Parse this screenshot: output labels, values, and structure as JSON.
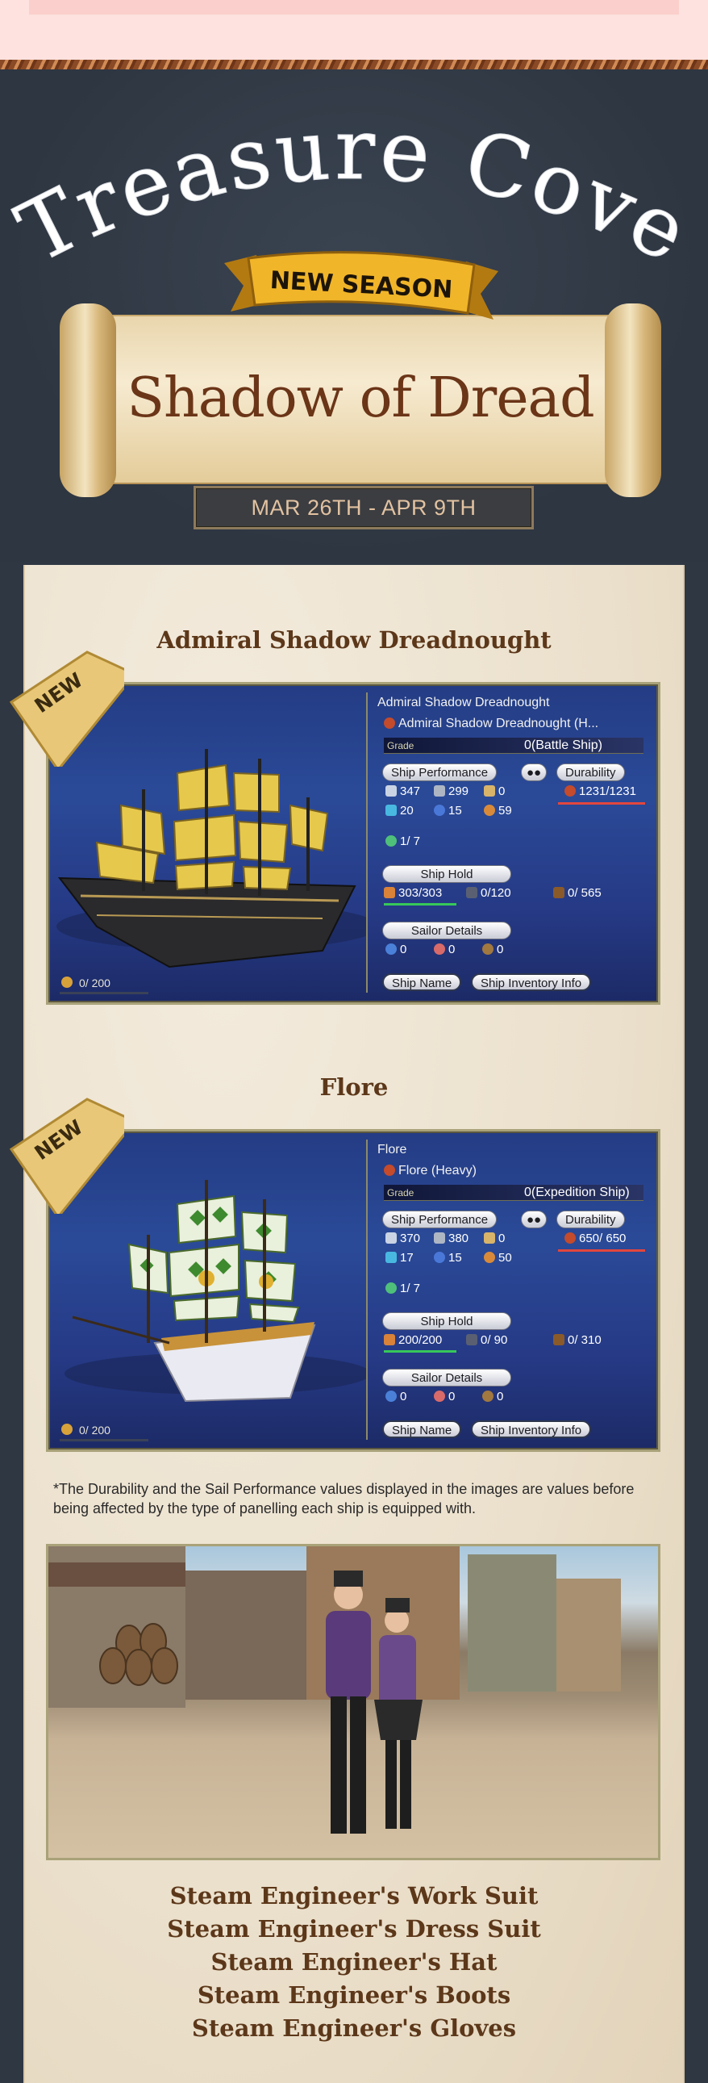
{
  "header": {
    "game_title": "Treasure Cove",
    "ribbon_label": "NEW SEASON",
    "event_name": "Shadow of Dread",
    "dates": "MAR 26TH - APR 9TH"
  },
  "colors": {
    "background": "#2f3743",
    "parchment": "#ebe0cc",
    "title_brown": "#5c3719",
    "card_blue": "#263a86",
    "gold": "#e0a72a"
  },
  "ships": [
    {
      "badge": "NEW",
      "title": "Admiral Shadow Dreadnought",
      "info_name": "Admiral Shadow Dreadnought",
      "info_subname": "Admiral Shadow Dreadnought (H...",
      "grade_label": "Grade",
      "grade_value": "0(Battle Ship)",
      "perf_label": "Ship Performance",
      "dur_label": "Durability",
      "durability": "1231/1231",
      "stats_row1": [
        "347",
        "299",
        "0"
      ],
      "stats_row2": [
        "20",
        "15",
        "59"
      ],
      "crew": "1/ 7",
      "hold_label": "Ship Hold",
      "hold": [
        "303/303",
        "0/120",
        "0/ 565"
      ],
      "sailor_label": "Sailor Details",
      "sailors": [
        "0",
        "0",
        "0"
      ],
      "capacity": "0/ 200",
      "btn_name": "Ship Name",
      "btn_inventory": "Ship Inventory Info"
    },
    {
      "badge": "NEW",
      "title": "Flore",
      "info_name": "Flore",
      "info_subname": "Flore (Heavy)",
      "grade_label": "Grade",
      "grade_value": "0(Expedition Ship)",
      "perf_label": "Ship Performance",
      "dur_label": "Durability",
      "durability": "650/ 650",
      "stats_row1": [
        "370",
        "380",
        "0"
      ],
      "stats_row2": [
        "17",
        "15",
        "50"
      ],
      "crew": "1/ 7",
      "hold_label": "Ship Hold",
      "hold": [
        "200/200",
        "0/ 90",
        "0/ 310"
      ],
      "sailor_label": "Sailor Details",
      "sailors": [
        "0",
        "0",
        "0"
      ],
      "capacity": "0/ 200",
      "btn_name": "Ship Name",
      "btn_inventory": "Ship Inventory Info"
    }
  ],
  "note": "*The Durability and the Sail Performance values displayed in the images are values before being affected by the type of panelling each ship is equipped with.",
  "items": [
    "Steam Engineer's Work Suit",
    "Steam Engineer's Dress Suit",
    "Steam Engineer's Hat",
    "Steam Engineer's Boots",
    "Steam Engineer's Gloves"
  ]
}
